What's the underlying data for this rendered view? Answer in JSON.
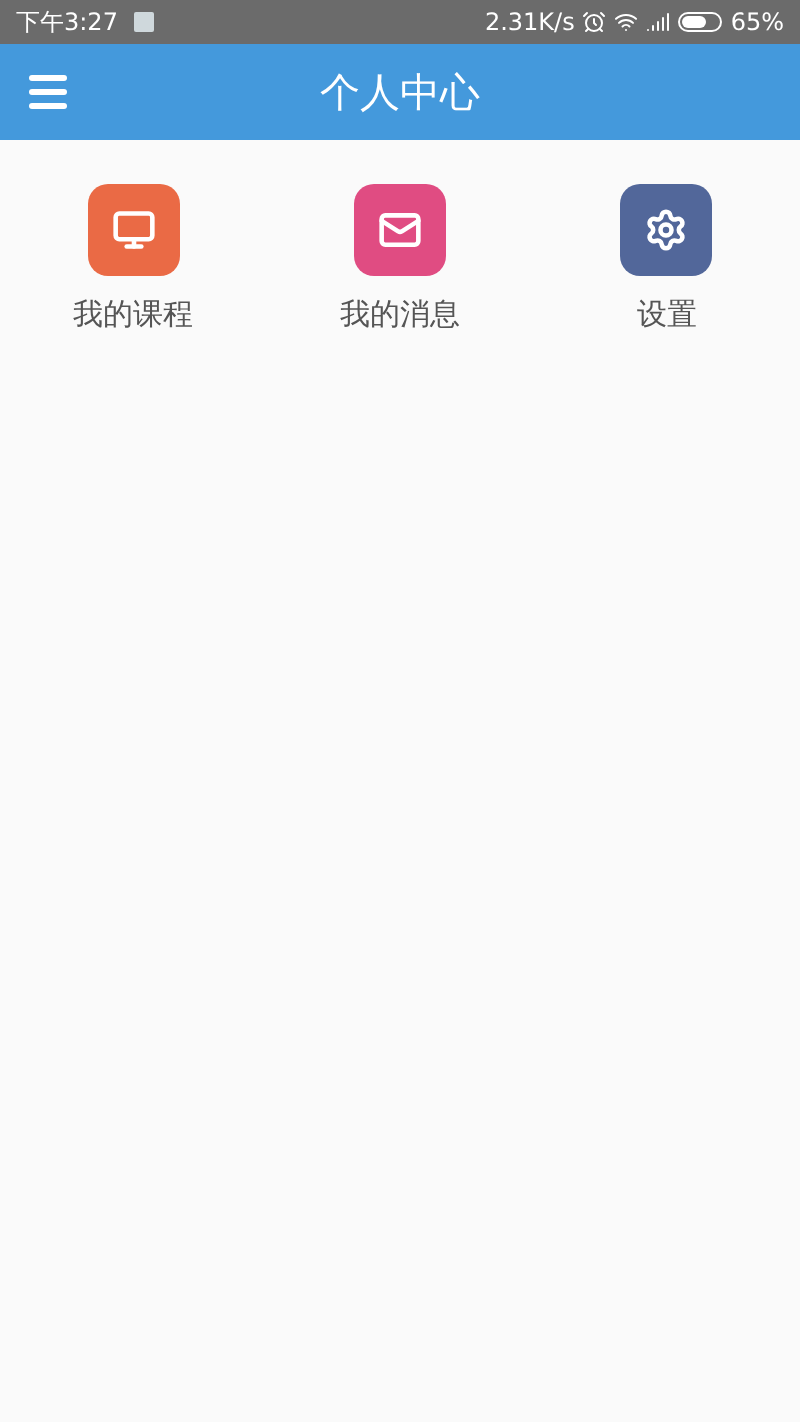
{
  "status_bar": {
    "time": "下午3:27",
    "speed": "2.31K/s",
    "battery": "65%"
  },
  "header": {
    "title": "个人中心"
  },
  "menu": [
    {
      "kind": "desk",
      "label": "我的课程",
      "color": "#ea6a45"
    },
    {
      "kind": "mail",
      "label": "我的消息",
      "color": "#e04c82"
    },
    {
      "kind": "gear",
      "label": "设置",
      "color": "#52679a"
    }
  ]
}
